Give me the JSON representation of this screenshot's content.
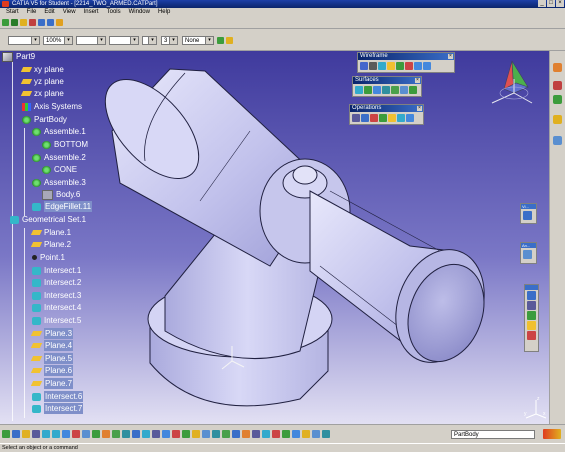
{
  "window": {
    "title": "CATIA V5 for Student - [2214_TWO_ARMED.CATPart]",
    "controls": [
      "_",
      "□",
      "×"
    ]
  },
  "menu": [
    "Start",
    "File",
    "Edit",
    "View",
    "Insert",
    "Tools",
    "Window",
    "Help"
  ],
  "properties_toolbar": {
    "combo1": "",
    "zoom": "100%",
    "line_type": "",
    "line_weight": "",
    "x_value": "",
    "layer_number": "3",
    "layer": "None"
  },
  "tree": {
    "items": [
      {
        "label": "Part9",
        "icon": "part-icon",
        "selected": false
      },
      {
        "label": "xy plane",
        "icon": "plane-icon",
        "selected": false
      },
      {
        "label": "yz plane",
        "icon": "plane-icon",
        "selected": false
      },
      {
        "label": "zx plane",
        "icon": "plane-icon",
        "selected": false
      },
      {
        "label": "Axis Systems",
        "icon": "axis-system-icon",
        "selected": false
      },
      {
        "label": "PartBody",
        "icon": "gear-icon",
        "selected": false
      },
      {
        "label": "Assemble.1",
        "icon": "assemble-icon",
        "selected": false
      },
      {
        "label": "BOTTOM",
        "icon": "body-icon",
        "selected": false
      },
      {
        "label": "Assemble.2",
        "icon": "assemble-icon",
        "selected": false
      },
      {
        "label": "CONE",
        "icon": "body-icon",
        "selected": false
      },
      {
        "label": "Assemble.3",
        "icon": "assemble-icon",
        "selected": false
      },
      {
        "label": "Body.6",
        "icon": "body-icon",
        "selected": false
      },
      {
        "label": "EdgeFillet.11",
        "icon": "fillet-icon",
        "selected": true
      },
      {
        "label": "Geometrical Set.1",
        "icon": "geoset-icon",
        "selected": false
      },
      {
        "label": "Plane.1",
        "icon": "plane-icon",
        "selected": false
      },
      {
        "label": "Plane.2",
        "icon": "plane-icon",
        "selected": false
      },
      {
        "label": "Point.1",
        "icon": "point-icon",
        "selected": false
      },
      {
        "label": "Intersect.1",
        "icon": "intersect-icon",
        "selected": false
      },
      {
        "label": "Intersect.2",
        "icon": "intersect-icon",
        "selected": false
      },
      {
        "label": "Intersect.3",
        "icon": "intersect-icon",
        "selected": false
      },
      {
        "label": "Intersect.4",
        "icon": "intersect-icon",
        "selected": false
      },
      {
        "label": "Intersect.5",
        "icon": "intersect-icon",
        "selected": false
      },
      {
        "label": "Plane.3",
        "icon": "plane-icon",
        "selected": true
      },
      {
        "label": "Plane.4",
        "icon": "plane-icon",
        "selected": true
      },
      {
        "label": "Plane.5",
        "icon": "plane-icon",
        "selected": true
      },
      {
        "label": "Plane.6",
        "icon": "plane-icon",
        "selected": true
      },
      {
        "label": "Plane.7",
        "icon": "plane-icon",
        "selected": true
      },
      {
        "label": "Intersect.6",
        "icon": "intersect-icon",
        "selected": true
      },
      {
        "label": "Intersect.7",
        "icon": "intersect-icon",
        "selected": true
      }
    ]
  },
  "panels": {
    "wireframe": "Wireframe",
    "surfaces": "Surfaces",
    "operations": "Operations",
    "vi_label": "Vi...",
    "an_label": "An..."
  },
  "compass_axes": [
    "x",
    "y",
    "z"
  ],
  "bottom_combo": "PartBody",
  "status": "Select an object or a command",
  "colors": {
    "viewport_top": "#3f3a9d",
    "viewport_bottom": "#e2e0f3",
    "selection": "#7f8fc9",
    "title_bar": "#0a246a",
    "part_face": "#c9c9ee"
  }
}
